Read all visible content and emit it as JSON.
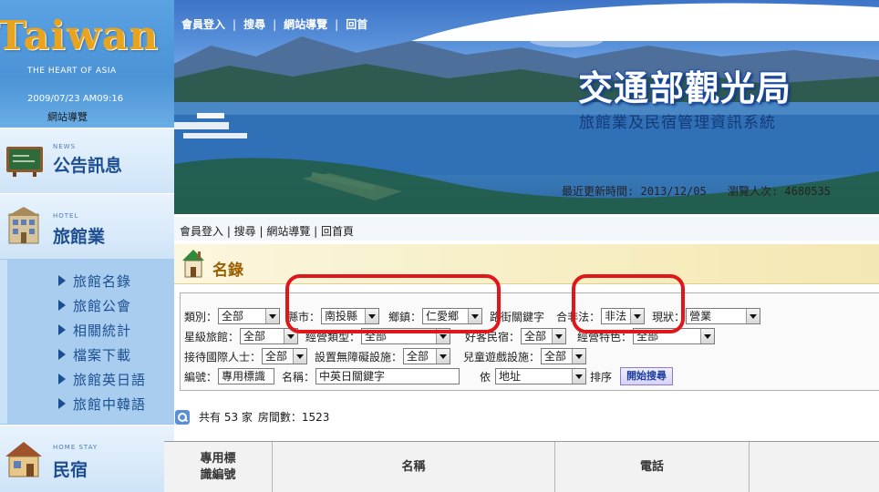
{
  "sidebar": {
    "logo": "Taiwan",
    "logo_sub": "THE HEART OF ASIA",
    "datetime": "2009/07/23 AM09:16",
    "sitemap": "網站導覽",
    "news": {
      "eng": "NEWS",
      "label": "公告訊息"
    },
    "hotel": {
      "eng": "HOTEL",
      "label": "旅館業"
    },
    "menu": [
      {
        "label": "旅館名錄"
      },
      {
        "label": "旅館公會"
      },
      {
        "label": "相關統計"
      },
      {
        "label": "檔案下載"
      },
      {
        "label": "旅館英日語"
      },
      {
        "label": "旅館中韓語"
      }
    ],
    "homestay": {
      "eng": "HOME STAY",
      "label": "民宿"
    }
  },
  "banner": {
    "links": [
      "會員登入",
      "搜尋",
      "網站導覽",
      "回首"
    ],
    "separator": "|",
    "title": "交通部觀光局",
    "subtitle": "旅館業及民宿管理資訊系統",
    "updated_label": "最近更新時間:",
    "updated_value": "2013/12/05",
    "visits_label": "瀏覽人次:",
    "visits_value": "4680535"
  },
  "nav": {
    "text": "會員登入 | 搜尋 | 網站導覽 | 回首頁"
  },
  "list": {
    "title": "名錄"
  },
  "filters": {
    "row1": {
      "category_label": "類別：",
      "category_value": "全部",
      "county_label": "縣市：",
      "county_value": "南投縣",
      "township_label": "鄉鎮：",
      "township_value": "仁愛鄉",
      "street_label": "路街關鍵字",
      "legal_label": "合非法：",
      "legal_value": "非法",
      "status_label": "現狀：",
      "status_value": "營業"
    },
    "row2": {
      "star_label": "星級旅館：",
      "star_value": "全部",
      "type_label": "經營類型：",
      "type_value": "全部",
      "friendly_label": "好客民宿：",
      "friendly_value": "全部",
      "feature_label": "經營特色：",
      "feature_value": "全部"
    },
    "row3": {
      "intl_label": "接待國際人士：",
      "intl_value": "全部",
      "barrier_label": "設置無障礙設施：",
      "barrier_value": "全部",
      "kids_label": "兒童遊戲設施：",
      "kids_value": "全部"
    },
    "row4": {
      "id_label": "編號：",
      "id_value": "專用標識",
      "name_label": "名稱：",
      "name_value": "中英日關鍵字",
      "by_label": "依",
      "by_value": "地址",
      "sort_label": "排序",
      "search_button": "開始搜尋"
    }
  },
  "summary": {
    "count_text": "共有 53 家",
    "rooms_text": "房間數：1523"
  },
  "table": {
    "headers": [
      "專用標\n識編號",
      "名稱",
      "電話",
      ""
    ]
  },
  "colors": {
    "accent_blue": "#1d4e91",
    "callout_red": "#e0161b",
    "title_gold": "#9b5f00"
  }
}
